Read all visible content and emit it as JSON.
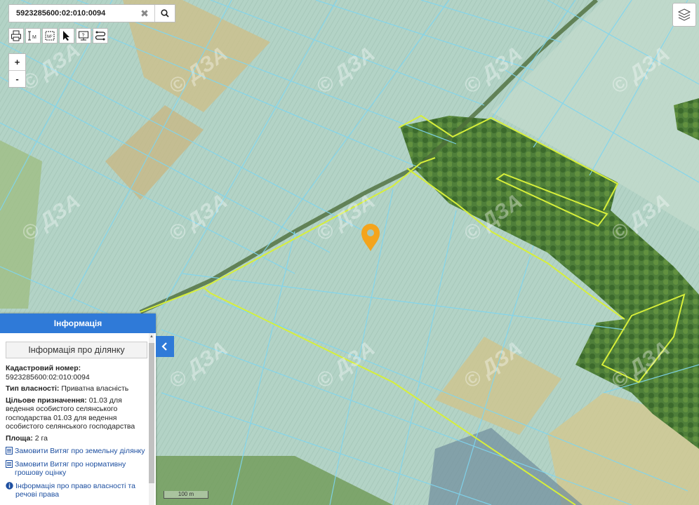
{
  "search": {
    "value": "5923285600:02:010:0094"
  },
  "watermark": "© ДЗА",
  "zoom": {
    "in_label": "+",
    "out_label": "-"
  },
  "scale_label": "100 m",
  "info_panel": {
    "header": "Інформація",
    "subtitle": "Інформація про ділянку",
    "cadastral_label": "Кадастровий номер:",
    "cadastral_value": "5923285600:02:010:0094",
    "ownership_label": "Тип власності:",
    "ownership_value": " Приватна власність",
    "purpose_label": "Цільове призначення:",
    "purpose_value": " 01.03 для ведення особистого селянського господарства 01.03 для ведення особистого селянського господарства",
    "area_label": "Площа:",
    "area_value": " 2 га",
    "links": [
      "Замовити Витяг про земельну ділянку",
      "Замовити Витяг про нормативну грошову оцінку",
      "Інформація про право власності та речові права"
    ]
  },
  "colors": {
    "panel_header": "#2f7ad8",
    "marker": "#f4a41c",
    "parcel_lines": "#7fd6f0",
    "highlight_parcel": "#d7ef3a"
  }
}
